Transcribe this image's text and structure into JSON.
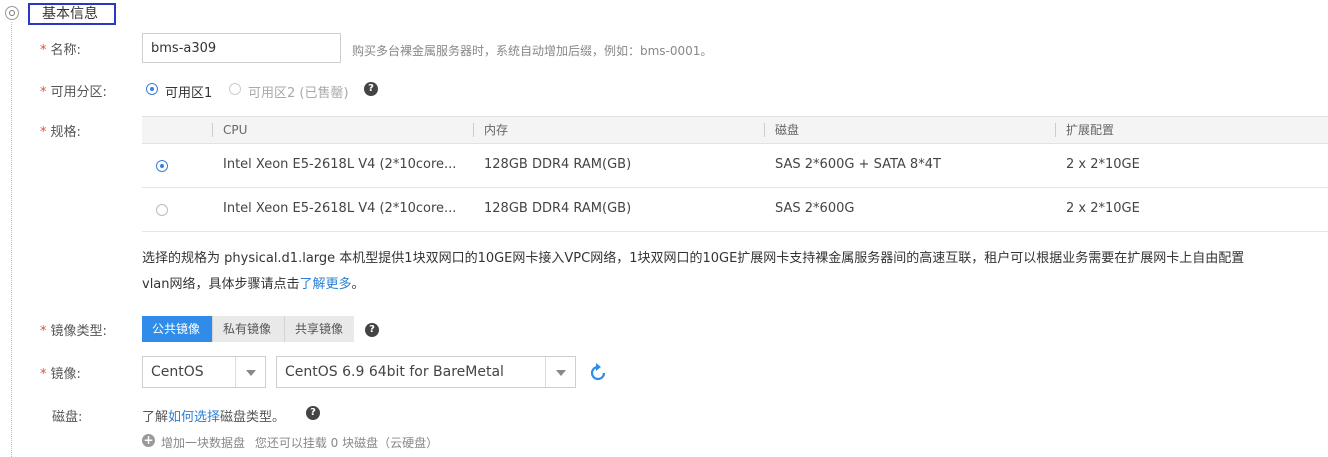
{
  "section": {
    "title": "基本信息"
  },
  "name": {
    "label": "名称:",
    "value": "bms-a309",
    "hint": "购买多台裸金属服务器时，系统自动增加后缀，例如：bms-0001。"
  },
  "zone": {
    "label": "可用分区:",
    "options": [
      {
        "label": "可用区1",
        "selected": true,
        "disabled": false
      },
      {
        "label": "可用区2 (已售罄)",
        "selected": false,
        "disabled": true
      }
    ]
  },
  "spec": {
    "label": "规格:",
    "columns": [
      "CPU",
      "内存",
      "磁盘",
      "扩展配置"
    ],
    "rows": [
      {
        "selected": true,
        "cpu": "Intel Xeon E5-2618L V4 (2*10core...",
        "memory": "128GB DDR4 RAM(GB)",
        "disk": "SAS 2*600G + SATA 8*4T",
        "ext": "2 x 2*10GE"
      },
      {
        "selected": false,
        "cpu": "Intel Xeon E5-2618L V4 (2*10core...",
        "memory": "128GB DDR4 RAM(GB)",
        "disk": "SAS 2*600G",
        "ext": "2 x 2*10GE"
      }
    ],
    "desc_line1": "选择的规格为 physical.d1.large   本机型提供1块双网口的10GE网卡接入VPC网络，1块双网口的10GE扩展网卡支持裸金属服务器间的高速互联，租户可以根据业务需要在扩展网卡上自由配置",
    "desc_line2": "vlan网络，具体步骤请点击",
    "desc_link": "了解更多",
    "desc_end": "。"
  },
  "image_type": {
    "label": "镜像类型:",
    "tabs": [
      "公共镜像",
      "私有镜像",
      "共享镜像"
    ],
    "active": 0
  },
  "image": {
    "label": "镜像:",
    "os": "CentOS",
    "version": "CentOS 6.9 64bit for BareMetal"
  },
  "disk": {
    "label": "磁盘:",
    "text_prefix": "了解",
    "link": "如何选择",
    "text_suffix": "磁盘类型。",
    "add_label": "增加一块数据盘",
    "add_hint": "您还可以挂载 0 块磁盘（云硬盘）"
  },
  "icons": {
    "help": "question-circle-icon",
    "refresh": "refresh-icon",
    "add": "plus-circle-icon",
    "dropdown": "chevron-down-icon"
  },
  "colors": {
    "accent": "#2f8ce8",
    "required": "#e74c3c",
    "link": "#2a7fd4",
    "section_border": "#2a36c8"
  }
}
